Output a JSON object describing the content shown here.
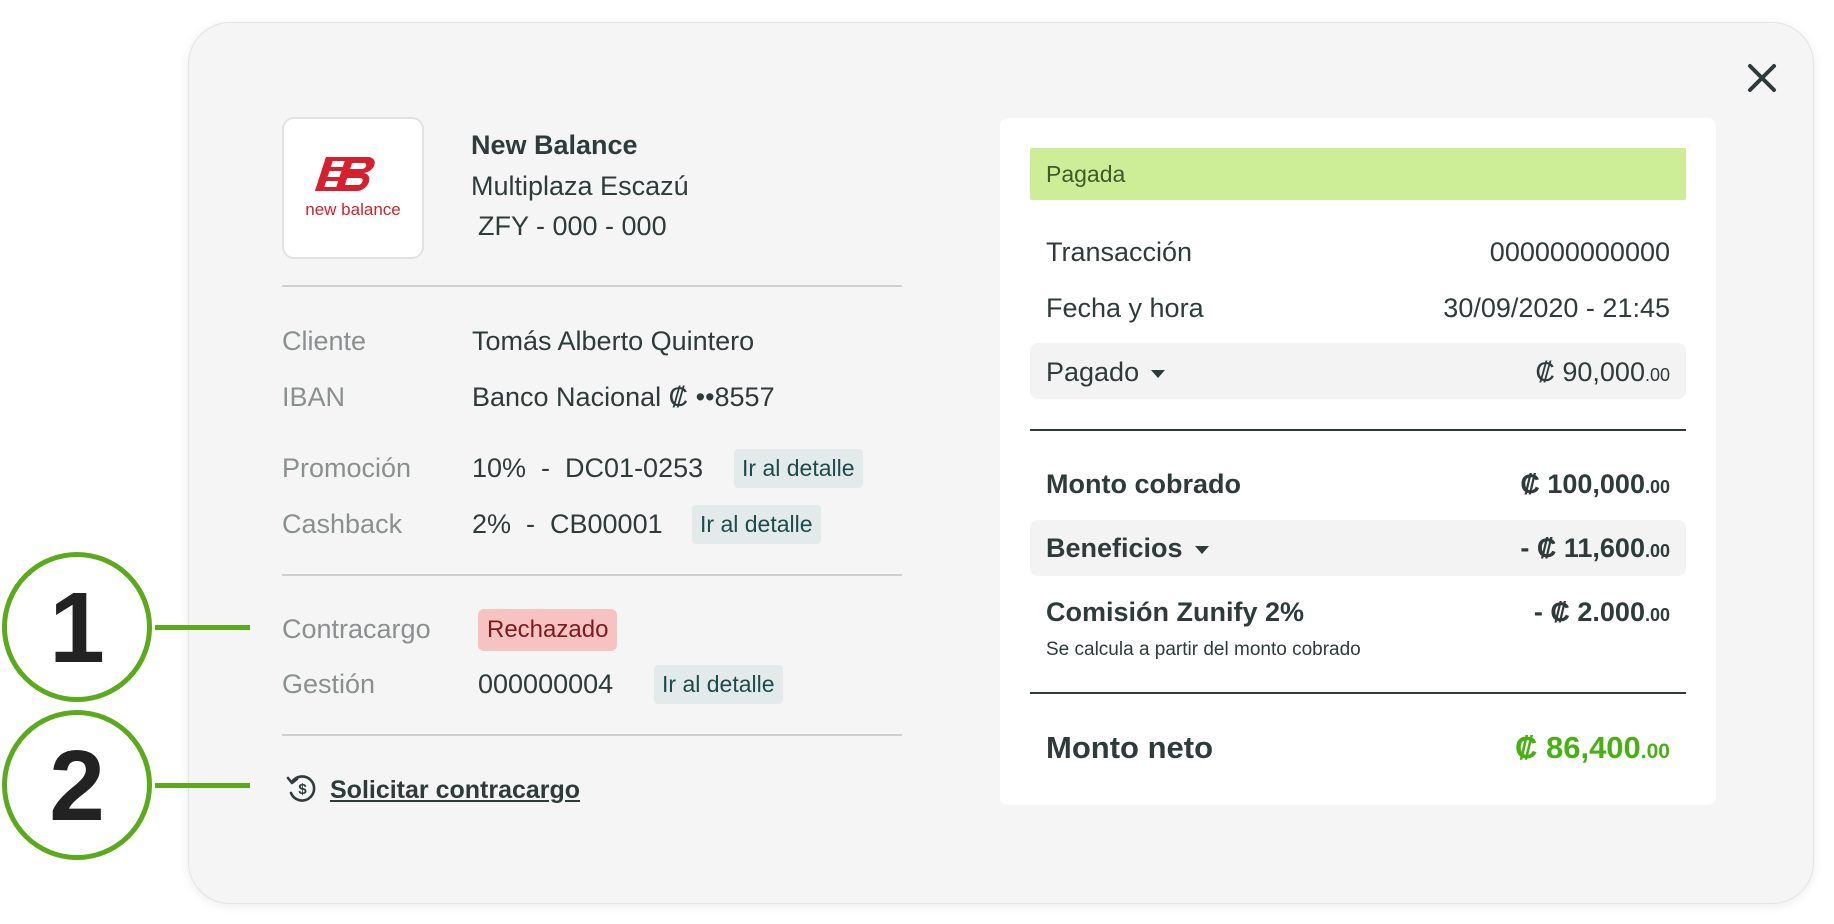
{
  "merchant": {
    "logo_text": "new balance",
    "name": "New Balance",
    "location": "Multiplaza Escazú",
    "code": "ZFY - 000 - 000"
  },
  "details": {
    "cliente_label": "Cliente",
    "cliente_value": "Tomás Alberto Quintero",
    "iban_label": "IBAN",
    "iban_value": "Banco Nacional ₡ ••8557",
    "promocion_label": "Promoción",
    "promocion_value": "10%  -  DC01-0253",
    "cashback_label": "Cashback",
    "cashback_value": "2%  -  CB00001",
    "detail_link": "Ir al detalle",
    "contracargo_label": "Contracargo",
    "contracargo_status": "Rechazado",
    "gestion_label": "Gestión",
    "gestion_value": "000000004",
    "request_link": "Solicitar contracargo"
  },
  "summary": {
    "status": "Pagada",
    "transaccion_label": "Transacción",
    "transaccion_value": "000000000000",
    "fecha_label": "Fecha y hora",
    "fecha_value": "30/09/2020 - 21:45",
    "pagado_label": "Pagado",
    "pagado_main": "₡ 90,000",
    "pagado_cents": ".00",
    "monto_cobrado_label": "Monto cobrado",
    "monto_cobrado_main": "₡ 100,000",
    "monto_cobrado_cents": ".00",
    "beneficios_label": "Beneficios",
    "beneficios_main": "- ₡ 11,600",
    "beneficios_cents": ".00",
    "comision_label": "Comisión Zunify 2%",
    "comision_main": "- ₡ 2.000",
    "comision_cents": ".00",
    "comision_note": "Se calcula a partir del monto cobrado",
    "monto_neto_label": "Monto neto",
    "monto_neto_main": "₡ 86,400",
    "monto_neto_cents": ".00"
  },
  "callouts": [
    "1",
    "2"
  ],
  "colors": {
    "accent_green": "#49b014",
    "status_bg": "#cdee96",
    "callout": "#5aaa1b",
    "rejected_bg": "#f6c2c2"
  }
}
